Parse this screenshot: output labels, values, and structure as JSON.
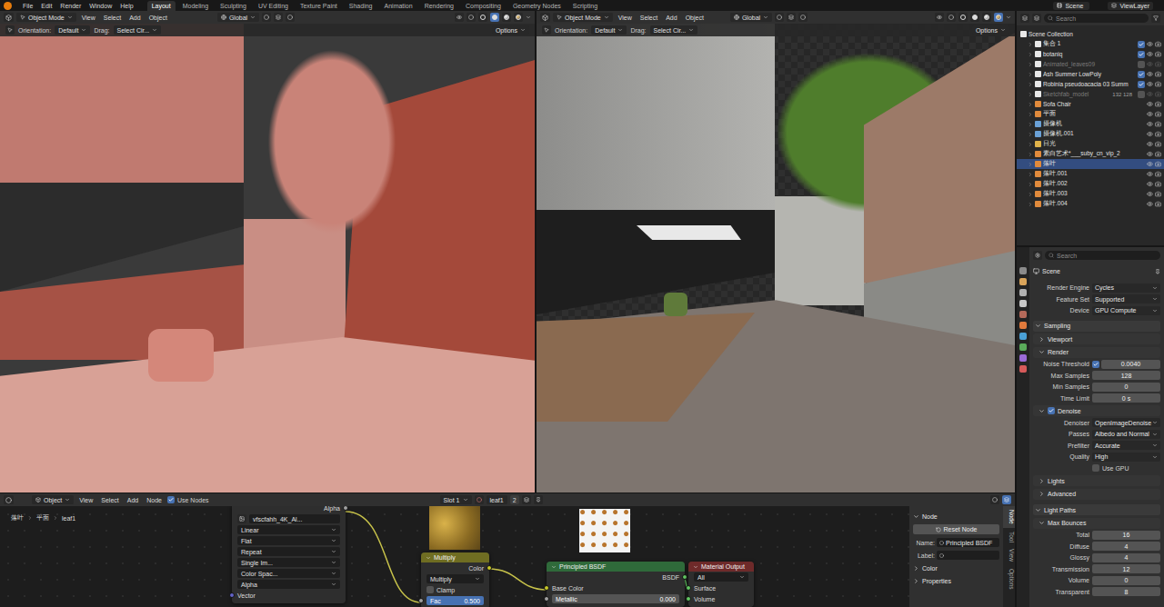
{
  "topbar": {
    "menus": [
      "File",
      "Edit",
      "Render",
      "Window",
      "Help"
    ],
    "workspaces": [
      {
        "label": "Layout",
        "selected": true
      },
      {
        "label": "Modeling",
        "selected": false
      },
      {
        "label": "Sculpting",
        "selected": false
      },
      {
        "label": "UV Editing",
        "selected": false
      },
      {
        "label": "Texture Paint",
        "selected": false
      },
      {
        "label": "Shading",
        "selected": false
      },
      {
        "label": "Animation",
        "selected": false
      },
      {
        "label": "Rendering",
        "selected": false
      },
      {
        "label": "Compositing",
        "selected": false
      },
      {
        "label": "Geometry Nodes",
        "selected": false
      },
      {
        "label": "Scripting",
        "selected": false
      }
    ],
    "scene": "Scene",
    "view_layer": "ViewLayer"
  },
  "viewports": [
    {
      "shading": "solid",
      "mode": "Object Mode",
      "menus": [
        "View",
        "Select",
        "Add",
        "Object"
      ],
      "transform": "Global",
      "orientation_label": "Orientation:",
      "orientation": "Default",
      "drag_label": "Drag:",
      "drag": "Select Cir...",
      "options": "Options"
    },
    {
      "shading": "rendered",
      "mode": "Object Mode",
      "menus": [
        "View",
        "Select",
        "Add",
        "Object"
      ],
      "transform": "Global",
      "orientation_label": "Orientation:",
      "orientation": "Default",
      "drag_label": "Drag:",
      "drag": "Select Cir...",
      "options": "Options"
    }
  ],
  "outliner": {
    "search": "Search",
    "root": "Scene Collection",
    "items": [
      {
        "name": "集合 1",
        "kind": "collection",
        "selected": false,
        "excluded": false
      },
      {
        "name": "botaniq",
        "kind": "collection",
        "selected": false,
        "excluded": false
      },
      {
        "name": "Animated_leaves09",
        "kind": "collection",
        "selected": false,
        "excluded": true
      },
      {
        "name": "Ash Summer LowPoly",
        "kind": "collection",
        "selected": false,
        "excluded": false
      },
      {
        "name": "Robinia pseudoacacia 03 Summ",
        "kind": "collection",
        "selected": false,
        "excluded": false
      },
      {
        "name": "Sketchfab_model",
        "kind": "collection",
        "selected": false,
        "excluded": true,
        "badge": "132 128"
      },
      {
        "name": "Sofa Chair",
        "kind": "object",
        "selected": false,
        "excluded": false
      },
      {
        "name": "平面",
        "kind": "object",
        "selected": false,
        "excluded": false
      },
      {
        "name": "摄像机",
        "kind": "camera",
        "selected": false,
        "excluded": false
      },
      {
        "name": "摄像机.001",
        "kind": "camera",
        "selected": false,
        "excluded": false
      },
      {
        "name": "日光",
        "kind": "light",
        "selected": false,
        "excluded": false
      },
      {
        "name": "素白艺术*___suby_cn_vip_2",
        "kind": "object",
        "selected": false,
        "excluded": false
      },
      {
        "name": "落叶",
        "kind": "object",
        "selected": true,
        "excluded": false
      },
      {
        "name": "落叶.001",
        "kind": "object",
        "selected": false,
        "excluded": false
      },
      {
        "name": "落叶.002",
        "kind": "object",
        "selected": false,
        "excluded": false
      },
      {
        "name": "落叶.003",
        "kind": "object",
        "selected": false,
        "excluded": false
      },
      {
        "name": "落叶.004",
        "kind": "object",
        "selected": false,
        "excluded": false
      }
    ]
  },
  "properties": {
    "search": "Search",
    "context": "Scene",
    "rows": [
      {
        "kind": "dropdown",
        "label": "Render Engine",
        "value": "Cycles"
      },
      {
        "kind": "dropdown",
        "label": "Feature Set",
        "value": "Supported"
      },
      {
        "kind": "dropdown",
        "label": "Device",
        "value": "GPU Compute"
      },
      {
        "kind": "panel",
        "label": "Sampling",
        "expanded": true
      },
      {
        "kind": "subpanel",
        "label": "Viewport",
        "expanded": false
      },
      {
        "kind": "subpanel",
        "label": "Render",
        "expanded": true
      },
      {
        "kind": "number",
        "label": "Noise Threshold",
        "value": "0.0040",
        "checked": true
      },
      {
        "kind": "number",
        "label": "Max Samples",
        "value": "128"
      },
      {
        "kind": "number",
        "label": "Min Samples",
        "value": "0"
      },
      {
        "kind": "number",
        "label": "Time Limit",
        "value": "0 s"
      },
      {
        "kind": "subpanel",
        "label": "Denoise",
        "expanded": true,
        "checked": true
      },
      {
        "kind": "dropdown",
        "label": "Denoiser",
        "value": "OpenImageDenoise"
      },
      {
        "kind": "dropdown",
        "label": "Passes",
        "value": "Albedo and Normal"
      },
      {
        "kind": "dropdown",
        "label": "Prefilter",
        "value": "Accurate"
      },
      {
        "kind": "dropdown",
        "label": "Quality",
        "value": "High"
      },
      {
        "kind": "check",
        "label": "Use GPU",
        "checked": false
      },
      {
        "kind": "subpanel",
        "label": "Lights",
        "expanded": false
      },
      {
        "kind": "subpanel",
        "label": "Advanced",
        "expanded": false
      },
      {
        "kind": "panel",
        "label": "Light Paths",
        "expanded": true
      },
      {
        "kind": "subpanel",
        "label": "Max Bounces",
        "expanded": true
      },
      {
        "kind": "number",
        "label": "Total",
        "value": "16"
      },
      {
        "kind": "number",
        "label": "Diffuse",
        "value": "4"
      },
      {
        "kind": "number",
        "label": "Glossy",
        "value": "4"
      },
      {
        "kind": "number",
        "label": "Transmission",
        "value": "12"
      },
      {
        "kind": "number",
        "label": "Volume",
        "value": "0"
      },
      {
        "kind": "number",
        "label": "Transparent",
        "value": "8"
      }
    ]
  },
  "node_editor": {
    "header": {
      "object": "Object",
      "menus": [
        "View",
        "Select",
        "Add",
        "Node"
      ],
      "use_nodes": {
        "label": "Use Nodes",
        "checked": true
      },
      "slot": "Slot 1",
      "material": "leaf1",
      "users": "2"
    },
    "breadcrumb": [
      "落叶",
      "平面",
      "leaf1"
    ],
    "image_node": {
      "output": "Alpha",
      "image": "vfscfahh_4K_Al...",
      "options": [
        "Linear",
        "Flat",
        "Repeat",
        "Single Im...",
        "Color Spac...",
        "Alpha"
      ],
      "input": "Vector"
    },
    "mix_node": {
      "title": "Multiply",
      "output": "Color",
      "blend": "Multiply",
      "clamp": {
        "label": "Clamp",
        "checked": false
      },
      "fac_label": "Fac",
      "fac": "0.500"
    },
    "bsdf_node": {
      "title": "Principled BSDF",
      "output": "BSDF",
      "input": "Base Color",
      "metallic_label": "Metallic",
      "metallic": "0.000"
    },
    "output_node": {
      "title": "Material Output",
      "target": "All",
      "inputs": [
        "Surface",
        "Volume"
      ]
    },
    "sidebar": {
      "tabs": [
        {
          "label": "Node",
          "selected": true
        },
        {
          "label": "Tool",
          "selected": false
        },
        {
          "label": "View",
          "selected": false
        },
        {
          "label": "Options",
          "selected": false
        }
      ],
      "panel": "Node",
      "reset": "Reset Node",
      "name_label": "Name:",
      "name": "Principled BSDF",
      "label_label": "Label:",
      "sections": [
        {
          "label": "Color",
          "expanded": false
        },
        {
          "label": "Properties",
          "expanded": false
        }
      ]
    }
  }
}
